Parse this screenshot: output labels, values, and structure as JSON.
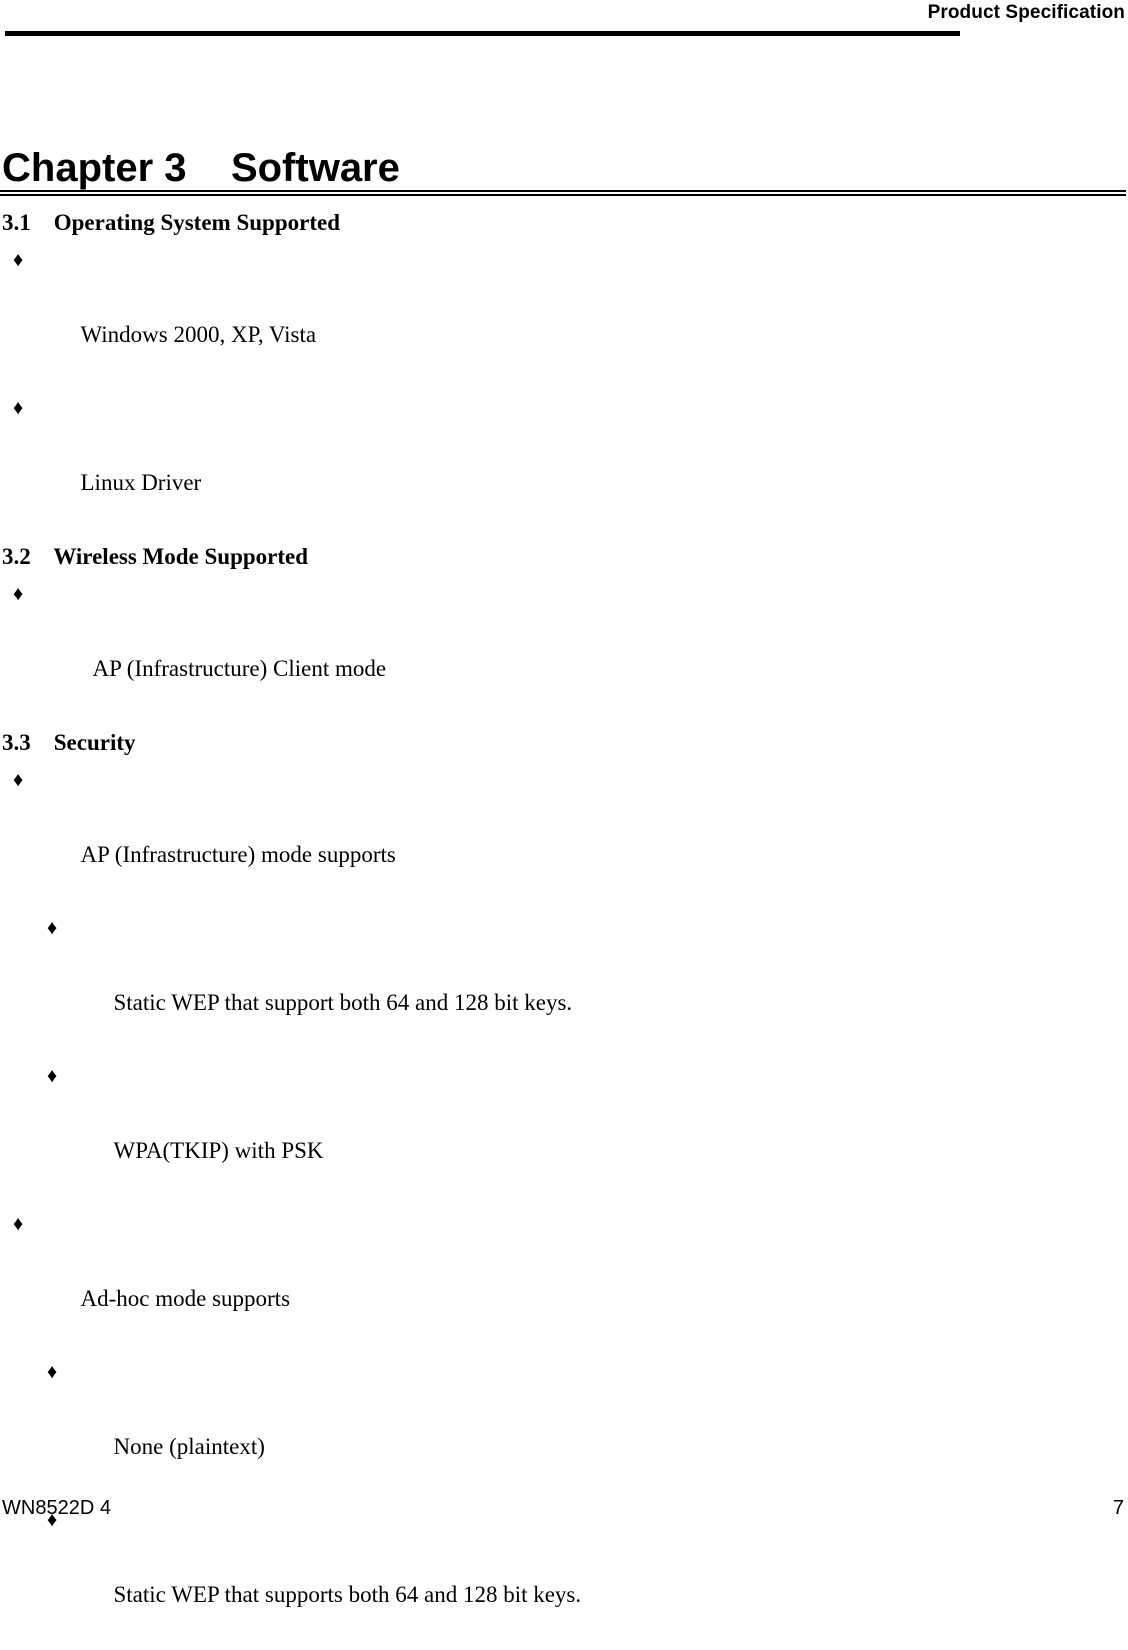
{
  "header": {
    "title": "Product Specification"
  },
  "chapter": {
    "title": "Chapter 3    Software"
  },
  "sections": [
    {
      "number": "3.1",
      "title": "Operating System Supported",
      "heading_text": "3.1    Operating System Supported",
      "items": [
        {
          "level": 1,
          "bullet": "diamond-bullet",
          "text": "Windows 2000, XP, Vista"
        },
        {
          "level": 1,
          "bullet": "diamond-bullet",
          "text": "Linux Driver"
        }
      ]
    },
    {
      "number": "3.2",
      "title": "Wireless Mode Supported",
      "heading_text": "3.2    Wireless Mode Supported",
      "items": [
        {
          "level": 1,
          "bullet": "diamond-bullet",
          "text": "AP (Infrastructure) Client mode"
        }
      ]
    },
    {
      "number": "3.3",
      "title": "Security",
      "heading_text": "3.3    Security",
      "items": [
        {
          "level": 1,
          "bullet": "diamond-bullet",
          "text": "AP (Infrastructure) mode supports"
        },
        {
          "level": 2,
          "bullet": "diamond-bullet",
          "text": "Static WEP that support both 64 and 128 bit keys."
        },
        {
          "level": 2,
          "bullet": "diamond-bullet",
          "text": "WPA(TKIP) with PSK"
        },
        {
          "level": 1,
          "bullet": "diamond-bullet",
          "text": "Ad-hoc mode supports"
        },
        {
          "level": 2,
          "bullet": "diamond-bullet",
          "text": "None (plaintext)"
        },
        {
          "level": 2,
          "bullet": "diamond-bullet",
          "text": "Static WEP that supports both 64 and 128 bit keys."
        }
      ]
    }
  ],
  "bullet_glyph": "♦",
  "footer": {
    "document_id": "WN8522D 4",
    "page_number": "7"
  },
  "colors": {
    "text": "#000000",
    "background": "#ffffff",
    "rule": "#000000"
  }
}
